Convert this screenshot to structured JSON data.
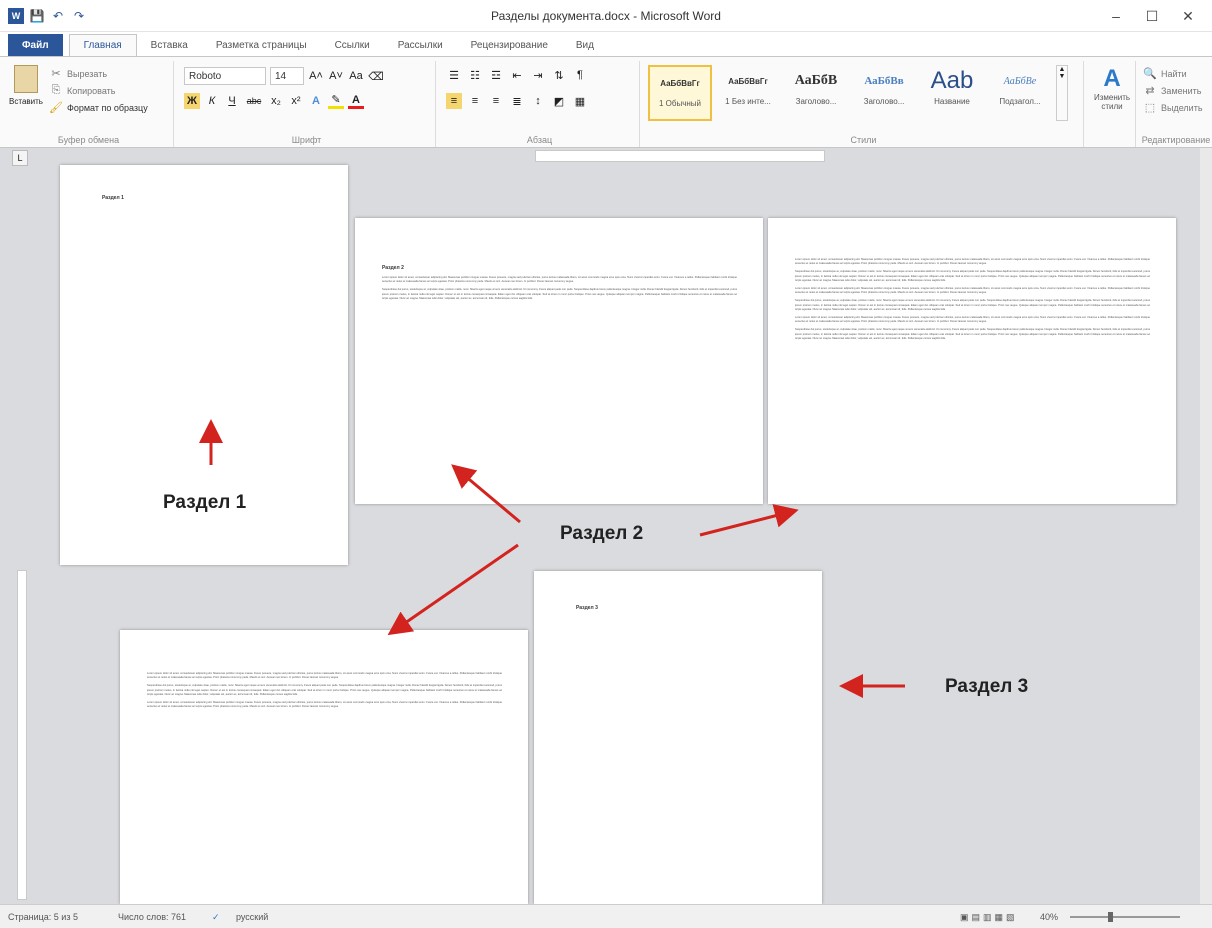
{
  "window": {
    "title": "Разделы документа.docx - Microsoft Word",
    "minimize": "–",
    "maximize": "☐",
    "close": "✕"
  },
  "qat": {
    "save": "💾",
    "undo": "↶",
    "redo": "↷"
  },
  "tabs": [
    {
      "label": "Файл"
    },
    {
      "label": "Главная"
    },
    {
      "label": "Вставка"
    },
    {
      "label": "Разметка страницы"
    },
    {
      "label": "Ссылки"
    },
    {
      "label": "Рассылки"
    },
    {
      "label": "Рецензирование"
    },
    {
      "label": "Вид"
    }
  ],
  "ribbon": {
    "clipboard": {
      "paste": "Вставить",
      "cut": "Вырезать",
      "copy": "Копировать",
      "format_painter": "Формат по образцу",
      "label": "Буфер обмена"
    },
    "font": {
      "name": "Roboto",
      "size": "14",
      "grow": "A˄",
      "shrink": "A˅",
      "case": "Aa",
      "clear": "⌫",
      "bold": "Ж",
      "italic": "К",
      "underline": "Ч",
      "strike": "abc",
      "sub": "x₂",
      "sup": "x²",
      "highlight_color": "#f2e100",
      "font_color": "#e81e1e",
      "label": "Шрифт"
    },
    "paragraph": {
      "label": "Абзац"
    },
    "styles": {
      "label": "Стили",
      "tiles": [
        {
          "preview": "АаБбВвГг",
          "name": "1 Обычный",
          "size": 8
        },
        {
          "preview": "АаБбВвГг",
          "name": "1 Без инте...",
          "size": 8
        },
        {
          "preview": "АаБбВ",
          "name": "Заголово...",
          "size": 14
        },
        {
          "preview": "АаБбВв",
          "name": "Заголово...",
          "size": 11
        },
        {
          "preview": "Aab",
          "name": "Название",
          "size": 24
        },
        {
          "preview": "АаБбВе",
          "name": "Подзагол...",
          "size": 10
        }
      ],
      "change_styles": "Изменить стили"
    },
    "editing": {
      "find": "Найти",
      "replace": "Заменить",
      "select": "Выделить",
      "label": "Редактирование"
    }
  },
  "pages": {
    "p1_marker": "Раздел 1",
    "p2_marker": "Раздел 2",
    "p5_marker": "Раздел 3",
    "lorem_short": "Lorem ipsum dolor sit amet, consectetuer adipiscing elit. Maecenas porttitor congue massa. Fusce posuere, magna sed pulvinar ultricies, purus lectus malesuada libero, sit amet commodo magna eros quis urna. Nunc viverra imperdiet enim. Fusce est. Vivamus a tellus. Pellentesque habitant morbi tristique senectus et netus et malesuada fames ac turpis egestas. Proin pharetra nonummy pede. Mauris et orci. Aenean nec lorem. In porttitor. Donec laoreet nonummy augue.",
    "lorem_long": "Suspendisse dui purus, scelerisque at, vulputate vitae, pretium mattis, nunc. Mauris eget neque at sem venenatis eleifend. Ut nonummy. Fusce aliquet pede non pede. Suspendisse dapibus lorem pellentesque magna. Integer nulla. Donec blandit feugiat ligula. Donec hendrerit, felis et imperdiet euismod, purus ipsum pretium metus, in lacinia nulla nisl eget sapien. Donec ut est in lectus consequat consequat. Etiam eget dui. Aliquam erat volutpat. Sed at lorem in nunc porta tristique. Proin nec augue. Quisque aliquam tempor magna. Pellentesque habitant morbi tristique senectus et netus et malesuada fames ac turpis egestas. Nunc ac magna. Maecenas odio dolor, vulputate vel, auctor ac, accumsan id, felis. Pellentesque cursus sagittis felis."
  },
  "annotations": {
    "section1": "Раздел 1",
    "section2": "Раздел 2",
    "section3": "Раздел 3",
    "arrow_color": "#d3231f"
  },
  "status": {
    "page": "Страница: 5 из 5",
    "words": "Число слов: 761",
    "lang": "русский",
    "zoom": "40%"
  }
}
